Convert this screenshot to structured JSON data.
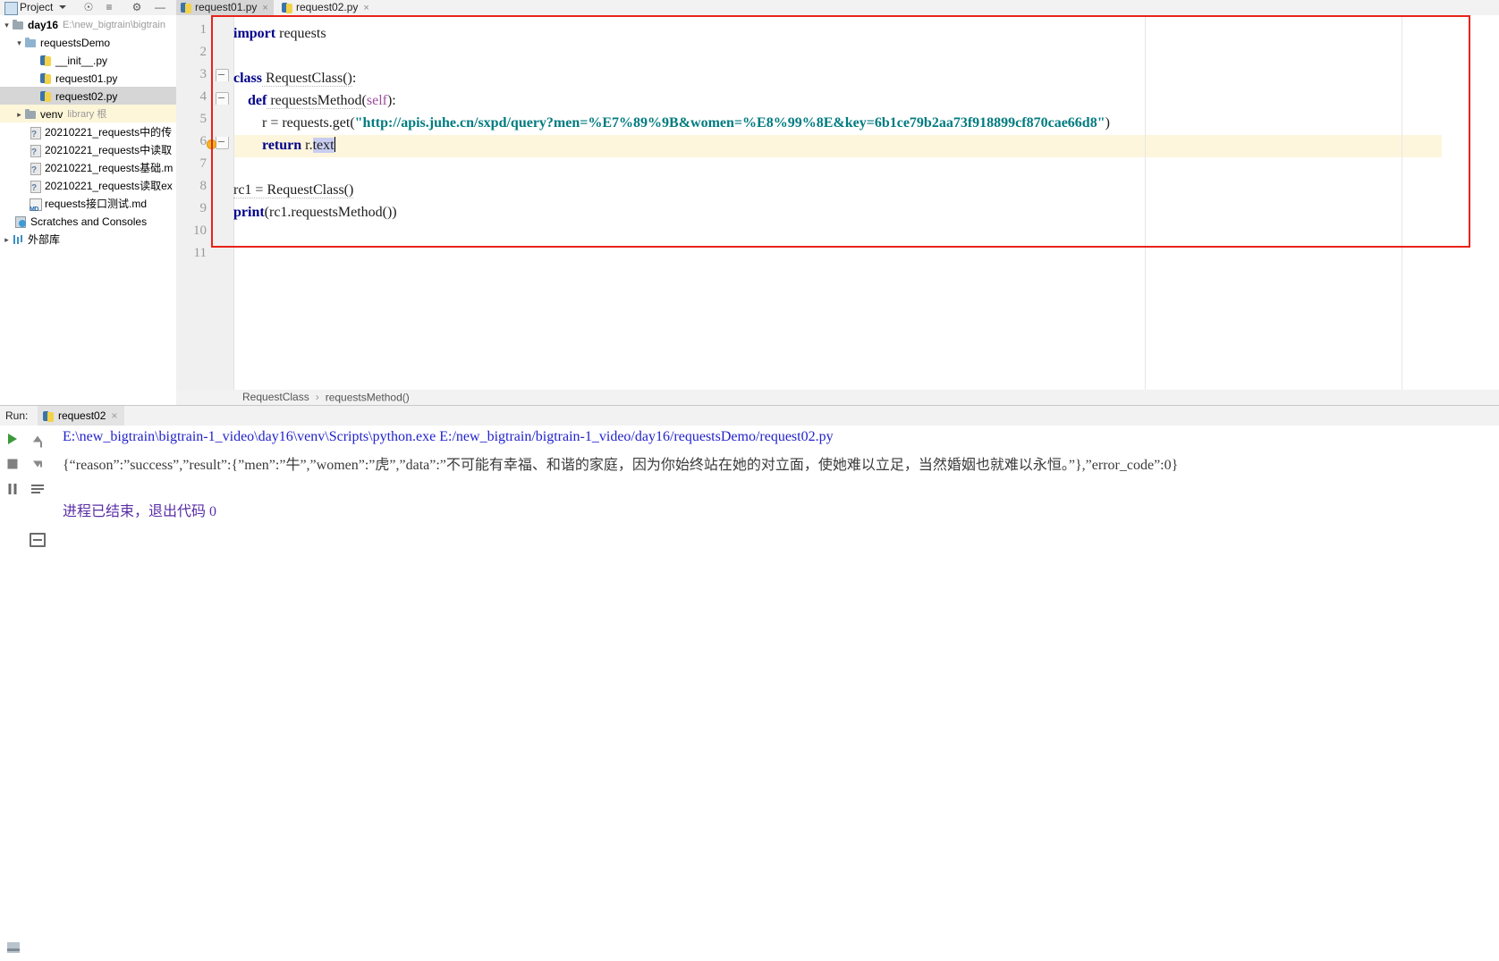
{
  "project_panel": {
    "title": "Project",
    "icons": [
      "project-icon",
      "chevron-down-icon",
      "locate-icon",
      "collapse-all-icon",
      "settings-icon",
      "minimize-icon"
    ],
    "tree": [
      {
        "label": "day16",
        "path": "E:\\new_bigtrain\\bigtrain",
        "icon": "folder-icon",
        "indent": 0,
        "arrow": "down",
        "bold": true,
        "state": "normal"
      },
      {
        "label": "requestsDemo",
        "path": "",
        "icon": "folder-source-icon",
        "indent": 1,
        "arrow": "down",
        "bold": false,
        "state": "normal"
      },
      {
        "label": "__init__.py",
        "path": "",
        "icon": "python-file-icon",
        "indent": 3,
        "arrow": "none",
        "bold": false,
        "state": "normal"
      },
      {
        "label": "request01.py",
        "path": "",
        "icon": "python-file-icon",
        "indent": 3,
        "arrow": "none",
        "bold": false,
        "state": "normal"
      },
      {
        "label": "request02.py",
        "path": "",
        "icon": "python-file-icon",
        "indent": 3,
        "arrow": "none",
        "bold": false,
        "state": "selected"
      },
      {
        "label": "venv",
        "path": "library 根",
        "icon": "folder-icon",
        "indent": 1,
        "arrow": "right",
        "bold": false,
        "state": "highlight"
      },
      {
        "label": "20210221_requests中的传",
        "path": "",
        "icon": "unknown-file-icon",
        "indent": 2,
        "arrow": "none",
        "bold": false,
        "state": "normal"
      },
      {
        "label": "20210221_requests中读取",
        "path": "",
        "icon": "unknown-file-icon",
        "indent": 2,
        "arrow": "none",
        "bold": false,
        "state": "normal"
      },
      {
        "label": "20210221_requests基础.m",
        "path": "",
        "icon": "unknown-file-icon",
        "indent": 2,
        "arrow": "none",
        "bold": false,
        "state": "normal"
      },
      {
        "label": "20210221_requests读取ex",
        "path": "",
        "icon": "unknown-file-icon",
        "indent": 2,
        "arrow": "none",
        "bold": false,
        "state": "normal"
      },
      {
        "label": "requests接口测试.md",
        "path": "",
        "icon": "markdown-file-icon",
        "indent": 2,
        "arrow": "none",
        "bold": false,
        "state": "normal"
      },
      {
        "label": "Scratches and Consoles",
        "path": "",
        "icon": "scratches-icon",
        "indent": 1,
        "arrow": "none",
        "bold": false,
        "state": "normal"
      },
      {
        "label": "外部库",
        "path": "",
        "icon": "library-icon",
        "indent": 0,
        "arrow": "right",
        "bold": false,
        "state": "normal"
      }
    ]
  },
  "tabs": [
    {
      "label": "request01.py",
      "active": false,
      "close": "×"
    },
    {
      "label": "request02.py",
      "active": true,
      "close": "×"
    }
  ],
  "editor": {
    "line_numbers": [
      "1",
      "2",
      "3",
      "4",
      "5",
      "6",
      "7",
      "8",
      "9",
      "10",
      "11"
    ],
    "lines": [
      {
        "n": 1,
        "segments": [
          {
            "t": "import",
            "c": "kw"
          },
          {
            "t": " requests",
            "c": "soft"
          }
        ]
      },
      {
        "n": 2,
        "segments": []
      },
      {
        "n": 3,
        "segments": [
          {
            "t": "class",
            "c": "kw"
          },
          {
            "t": " RequestClass():",
            "c": "soft"
          }
        ]
      },
      {
        "n": 4,
        "segments": [
          {
            "t": "    ",
            "c": "soft"
          },
          {
            "t": "def",
            "c": "kw"
          },
          {
            "t": " requestsMethod(",
            "c": "soft"
          },
          {
            "t": "self",
            "c": "selfk"
          },
          {
            "t": "):",
            "c": "soft"
          }
        ]
      },
      {
        "n": 5,
        "segments": [
          {
            "t": "        r = requests.get(",
            "c": "soft"
          },
          {
            "t": "\"http://apis.juhe.cn/sxpd/query?men=%E7%89%9B&women=%E8%99%8E&key=6b1ce79b2aa73f918899cf870cae66d8\"",
            "c": "str"
          },
          {
            "t": ")",
            "c": "soft"
          }
        ]
      },
      {
        "n": 6,
        "segments": [
          {
            "t": "        ",
            "c": "soft"
          },
          {
            "t": "return",
            "c": "kw"
          },
          {
            "t": " r.",
            "c": "soft"
          },
          {
            "t": "text",
            "c": "sel"
          }
        ]
      },
      {
        "n": 7,
        "segments": []
      },
      {
        "n": 8,
        "segments": [
          {
            "t": "rc1 = RequestClass()",
            "c": "soft"
          }
        ]
      },
      {
        "n": 9,
        "segments": [
          {
            "t": "print",
            "c": "kw"
          },
          {
            "t": "(rc1.requestsMethod())",
            "c": "soft"
          }
        ]
      },
      {
        "n": 10,
        "segments": []
      },
      {
        "n": 11,
        "segments": []
      }
    ],
    "highlighted_line": 6,
    "selection": "text",
    "intention_bulb": "lightbulb-icon",
    "red_annotation_box": "#e8231a"
  },
  "breadcrumb": {
    "class_name": "RequestClass",
    "separator": "›",
    "method_name": "requestsMethod()"
  },
  "run_panel": {
    "label": "Run:",
    "tab_label": "request02",
    "tab_close": "×",
    "toolbar": [
      "rerun-icon",
      "stop-icon",
      "pause-icon",
      "scroll-up-icon",
      "scroll-down-icon",
      "soft-wrap-icon",
      "print-icon"
    ],
    "output": [
      {
        "text": "E:\\new_bigtrain\\bigtrain-1_video\\day16\\venv\\Scripts\\python.exe E:/new_bigtrain/bigtrain-1_video/day16/requestsDemo/request02.py",
        "color": "blue"
      },
      {
        "text": "{“reason”:”success”,”result”:{”men”:”牛”,”women”:”虎”,”data”:”不可能有幸福、和谐的家庭，因为你始终站在她的对立面，使她难以立足，当然婚姻也就难以永恒。”},”error_code”:0}",
        "color": "dark"
      },
      {
        "text": "进程已结束，退出代码 0",
        "color": "purple"
      }
    ]
  },
  "status_bar": {
    "icon": "terminal-icon"
  },
  "colors": {
    "accent_red": "#e8231a",
    "keyword": "#00008b",
    "string": "#007b80",
    "highlight_line": "#fdf6dd",
    "selection": "#c8cdf0"
  }
}
